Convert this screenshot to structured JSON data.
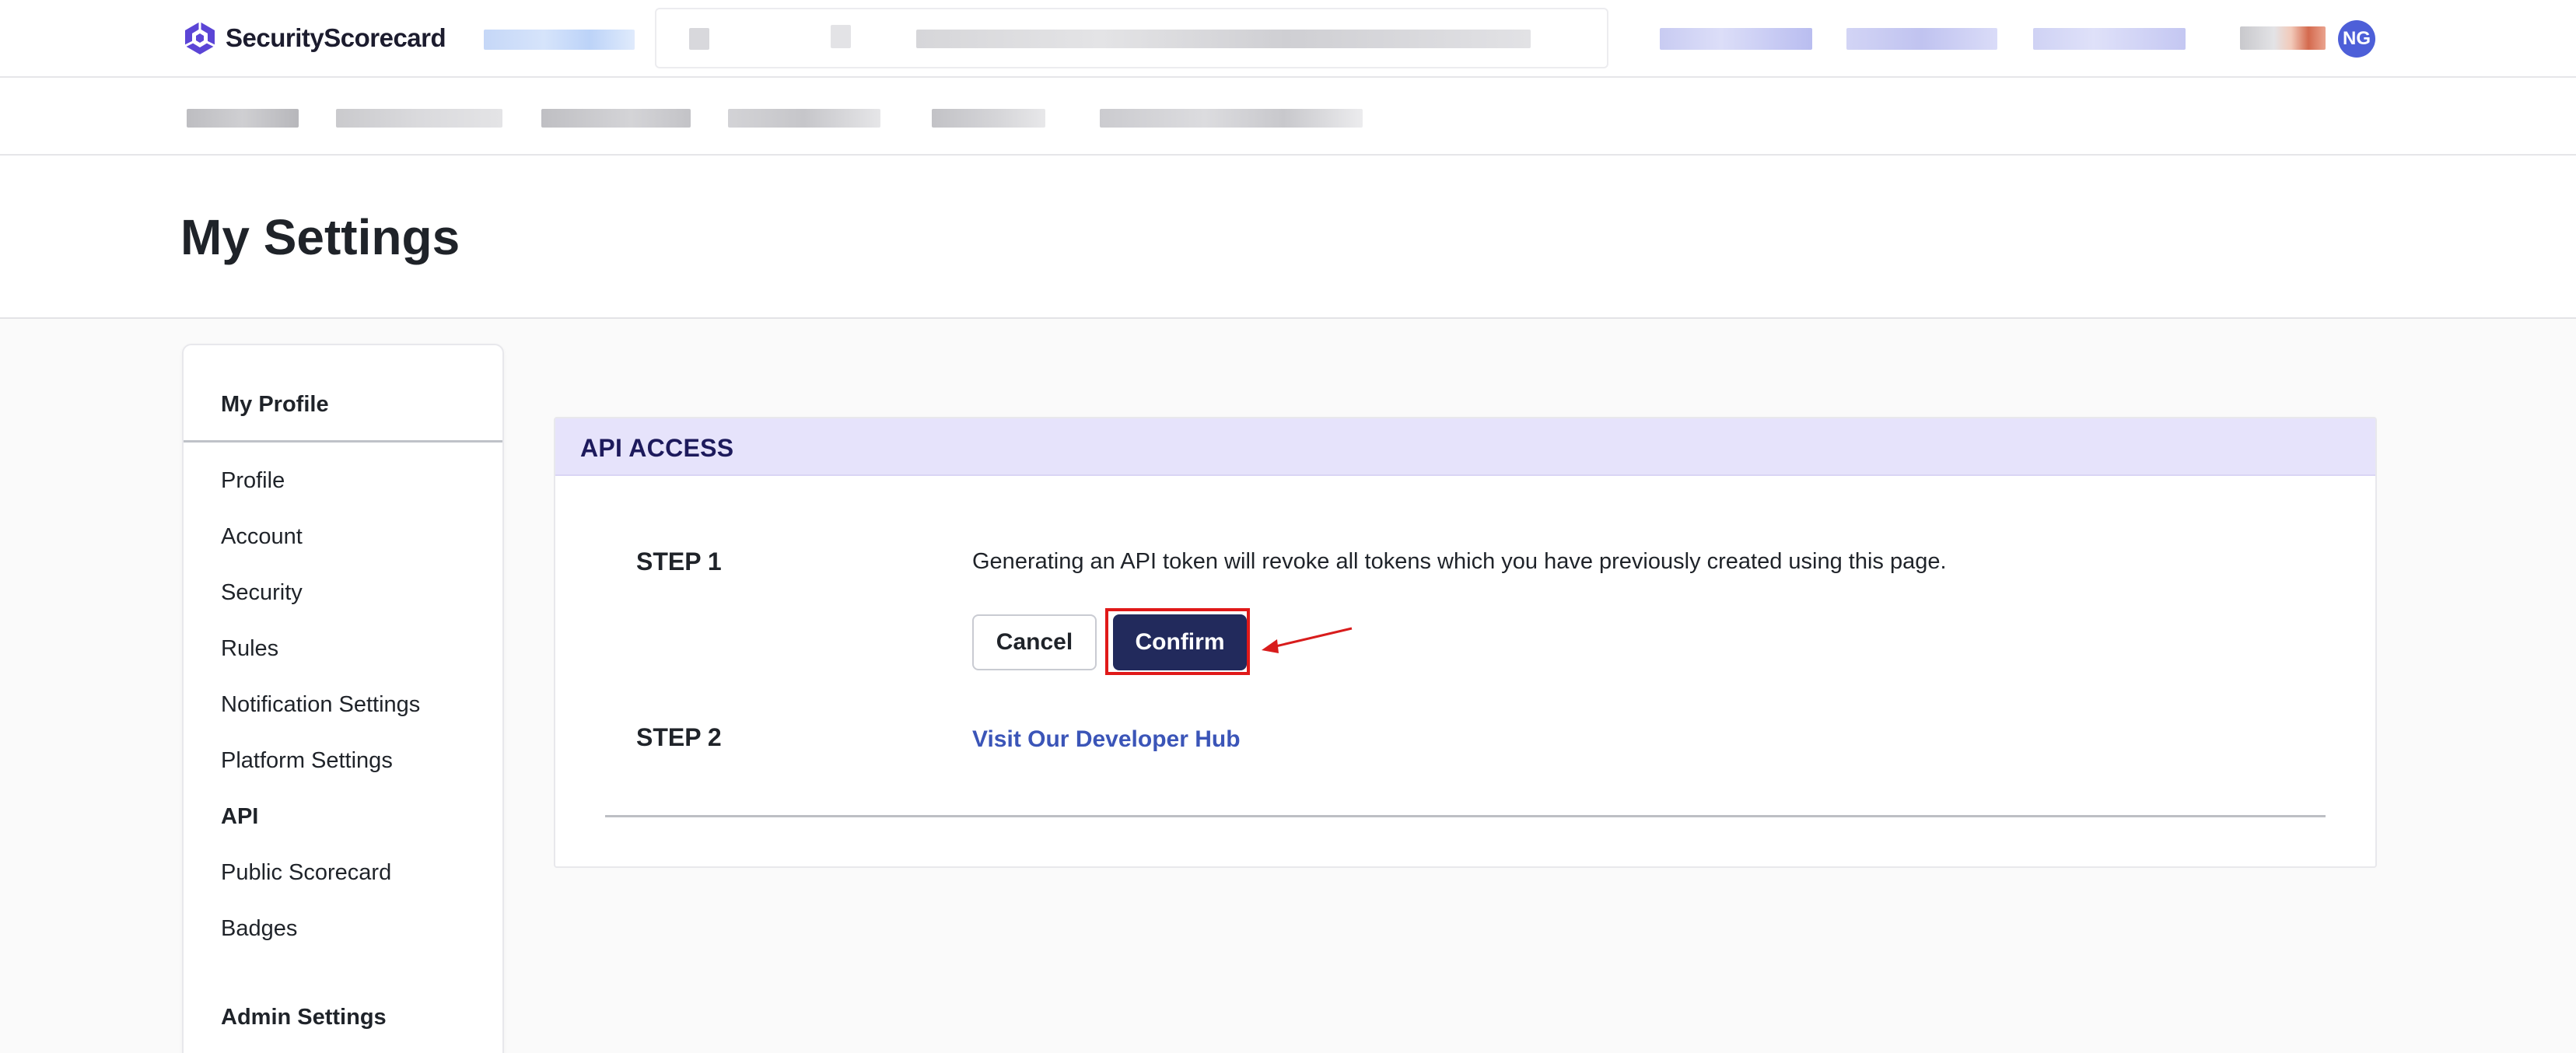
{
  "brand": {
    "name": "SecurityScorecard",
    "logo_color": "#5b45d6"
  },
  "user": {
    "initials": "NG",
    "avatar_color": "#4d5fd8"
  },
  "page": {
    "title": "My Settings"
  },
  "sidebar": {
    "section_profile": "My Profile",
    "items": [
      {
        "label": "Profile"
      },
      {
        "label": "Account"
      },
      {
        "label": "Security"
      },
      {
        "label": "Rules"
      },
      {
        "label": "Notification Settings"
      },
      {
        "label": "Platform Settings"
      },
      {
        "label": "API",
        "active": true
      },
      {
        "label": "Public Scorecard"
      },
      {
        "label": "Badges"
      }
    ],
    "section_admin": "Admin Settings"
  },
  "api_access": {
    "header": "API ACCESS",
    "header_bg": "#e6e3fb",
    "step1": {
      "label": "STEP 1",
      "description": "Generating an API token will revoke all tokens which you have previously created using this page.",
      "cancel_label": "Cancel",
      "confirm_label": "Confirm"
    },
    "step2": {
      "label": "STEP 2",
      "link_label": "Visit Our Developer Hub"
    }
  },
  "annotation": {
    "highlight_color": "#e01919"
  }
}
